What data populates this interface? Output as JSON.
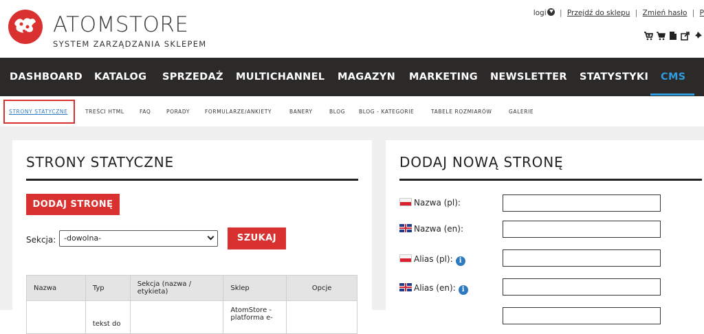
{
  "header": {
    "brand": "ATOMSTORE",
    "tagline": "SYSTEM ZARZĄDZANIA SKLEPEM",
    "toplinks": {
      "login": "logi",
      "shop_link": "Przejdź do sklepu",
      "password_link": "Zmień hasło",
      "partial_link": "P"
    },
    "tool_icons": [
      "cart-add-icon",
      "cart-icon",
      "document-icon",
      "export-icon",
      "pin-icon"
    ]
  },
  "main_nav": {
    "items": [
      "DASHBOARD",
      "KATALOG",
      "SPRZEDAŻ",
      "MULTICHANNEL",
      "MAGAZYN",
      "MARKETING",
      "NEWSLETTER",
      "STATYSTYKI",
      "CMS"
    ],
    "active": "CMS"
  },
  "sub_nav": {
    "items": [
      "STRONY STATYCZNE",
      "TREŚCI HTML",
      "FAQ",
      "PORADY",
      "FORMULARZE/ANKIETY",
      "BANERY",
      "BLOG",
      "BLOG - KATEGORIE",
      "TABELE ROZMIARÓW",
      "GALERIE"
    ],
    "active": "STRONY STATYCZNE"
  },
  "left_panel": {
    "title": "STRONY STATYCZNE",
    "add_button": "DODAJ STRONĘ",
    "section_label": "Sekcja:",
    "section_select": "-dowolna-",
    "search_button": "SZUKAJ",
    "table": {
      "headers": [
        "Nazwa",
        "Typ",
        "Sekcja (nazwa / etykieta)",
        "Sklep",
        "Opcje"
      ],
      "rows": [
        [
          "",
          "tekst do",
          "",
          "AtomStore - platforma e-",
          ""
        ]
      ]
    }
  },
  "right_panel": {
    "title": "DODAJ NOWĄ STRONĘ",
    "fields": [
      {
        "label": "Nazwa (pl):",
        "flag": "pl-flag-icon",
        "info": false,
        "value": ""
      },
      {
        "label": "Nazwa (en):",
        "flag": "en-flag-icon",
        "info": false,
        "value": ""
      },
      {
        "label": "Alias (pl):",
        "flag": "pl-flag-icon",
        "info": true,
        "value": ""
      },
      {
        "label": "Alias (en):",
        "flag": "en-flag-icon",
        "info": true,
        "value": ""
      }
    ]
  },
  "colors": {
    "accent_red": "#d9312f",
    "nav_bg": "#2b2a29",
    "active_blue": "#2e9cde"
  }
}
